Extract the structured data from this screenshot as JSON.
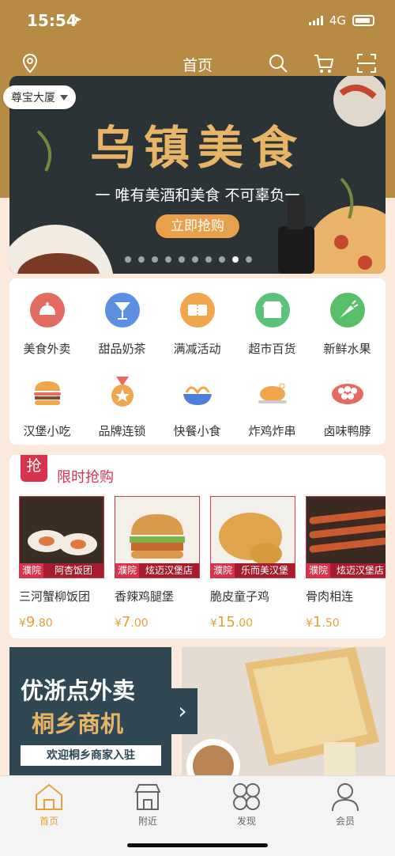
{
  "status": {
    "time": "15:54",
    "network": "4G"
  },
  "nav": {
    "title": "首页"
  },
  "location": {
    "label": "尊宝大厦"
  },
  "banner": {
    "title": "乌镇美食",
    "subtitle": "一 唯有美酒和美食  不可辜负一",
    "button_label": "立即抢购",
    "page_count": 10,
    "active_index": 8
  },
  "categories": [
    {
      "label": "美食外卖",
      "icon": "food-cover-icon",
      "color": "#e36b5f"
    },
    {
      "label": "甜品奶茶",
      "icon": "cocktail-icon",
      "color": "#5b8fe0"
    },
    {
      "label": "满减活动",
      "icon": "ticket-icon",
      "color": "#f0a64a"
    },
    {
      "label": "超市百货",
      "icon": "store-icon",
      "color": "#5cc27a"
    },
    {
      "label": "新鲜水果",
      "icon": "carrot-icon",
      "color": "#58c06a"
    },
    {
      "label": "汉堡小吃",
      "icon": "burger-icon",
      "color": "#f0a64a"
    },
    {
      "label": "品牌连锁",
      "icon": "medal-icon",
      "color": "#f0a64a"
    },
    {
      "label": "快餐小食",
      "icon": "noodle-bowl-icon",
      "color": "#4d7fd8"
    },
    {
      "label": "炸鸡炸串",
      "icon": "roast-chicken-icon",
      "color": "#f0a64a"
    },
    {
      "label": "卤味鸭脖",
      "icon": "braised-bowl-icon",
      "color": "#e36b5f"
    }
  ],
  "flash_sale": {
    "badge": "抢",
    "title": "限时抢购",
    "products": [
      {
        "name": "三河蟹柳饭团",
        "location": "濮院",
        "shop": "阿杏饭团",
        "currency": "¥",
        "price_int": "9",
        "price_dec": ".80",
        "img_color": "#3a2e24"
      },
      {
        "name": "香辣鸡腿堡",
        "location": "濮院",
        "shop": "炫迈汉堡店",
        "currency": "¥",
        "price_int": "7",
        "price_dec": ".00",
        "img_color": "#f4efe8"
      },
      {
        "name": "脆皮童子鸡",
        "location": "濮院",
        "shop": "乐而美汉堡",
        "currency": "¥",
        "price_int": "15",
        "price_dec": ".00",
        "img_color": "#f2f0ec"
      },
      {
        "name": "骨肉相连",
        "location": "濮院",
        "shop": "炫迈汉堡店",
        "currency": "¥",
        "price_int": "1",
        "price_dec": ".50",
        "img_color": "#3b2a22"
      }
    ]
  },
  "promo": {
    "line1": "优浙点外卖",
    "line2": "桐乡商机",
    "line3": "欢迎桐乡商家入驻"
  },
  "tabs": [
    {
      "label": "首页",
      "icon": "home-icon",
      "active": true
    },
    {
      "label": "附近",
      "icon": "shop-nearby-icon",
      "active": false
    },
    {
      "label": "发现",
      "icon": "discover-icon",
      "active": false
    },
    {
      "label": "会员",
      "icon": "member-icon",
      "active": false
    }
  ],
  "colors": {
    "brand": "#b88b45",
    "accent": "#d8334c",
    "price": "#e2a23a"
  }
}
